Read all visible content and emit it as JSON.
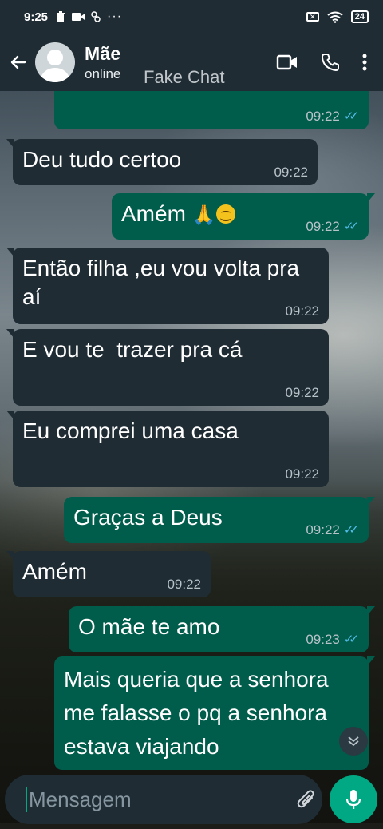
{
  "status_bar": {
    "time": "9:25",
    "battery": "24"
  },
  "header": {
    "contact_name": "Mãe",
    "contact_status": "online",
    "watermark": "Fake Chat"
  },
  "messages": [
    {
      "direction": "outgoing",
      "text": "",
      "time": "09:22",
      "read": true
    },
    {
      "direction": "incoming",
      "text": "Deu tudo certoo",
      "time": "09:22"
    },
    {
      "direction": "outgoing",
      "text": "Amém",
      "emoji": "🙏",
      "time": "09:22",
      "read": true
    },
    {
      "direction": "incoming",
      "text": "Então filha ,eu vou volta pra aí",
      "time": "09:22"
    },
    {
      "direction": "incoming",
      "text": "E vou te  trazer pra cá",
      "time": "09:22"
    },
    {
      "direction": "incoming",
      "text": "Eu comprei uma casa",
      "time": "09:22"
    },
    {
      "direction": "outgoing",
      "text": "Graças a Deus",
      "time": "09:22",
      "read": true
    },
    {
      "direction": "incoming",
      "text": "Amém",
      "time": "09:22"
    },
    {
      "direction": "outgoing",
      "text": "O mãe te amo",
      "time": "09:23",
      "read": true
    },
    {
      "direction": "outgoing",
      "text": "Mais queria que a senhora me falasse o pq a senhora estava viajando",
      "time": ""
    }
  ],
  "composer": {
    "placeholder": "Mensagem"
  },
  "icons": {
    "back": "back-arrow-icon",
    "video": "video-call-icon",
    "call": "phone-icon",
    "menu": "more-vert-icon",
    "keyboard": "keyboard-icon",
    "attach": "paperclip-icon",
    "camera": "camera-icon",
    "mic": "microphone-icon",
    "scroll": "chevron-double-down-icon"
  },
  "colors": {
    "header": "#1f2c34",
    "incoming_bubble": "#1f2c34",
    "outgoing_bubble": "#005c4b",
    "accent": "#00a884",
    "read_ticks": "#53bdeb"
  }
}
